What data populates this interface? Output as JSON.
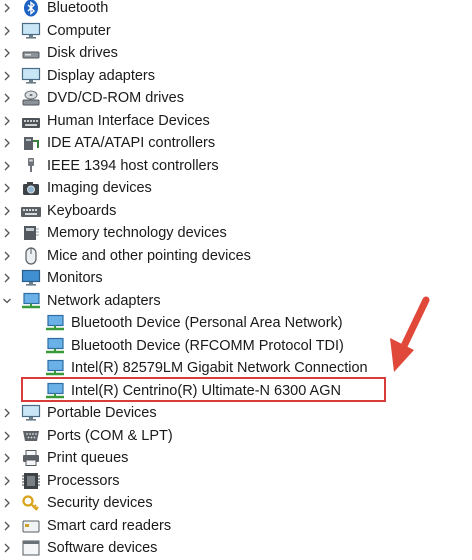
{
  "tree": {
    "items": [
      {
        "label": "Bluetooth",
        "icon": "bluetooth-icon",
        "expanded": false
      },
      {
        "label": "Computer",
        "icon": "monitor-icon",
        "expanded": false
      },
      {
        "label": "Disk drives",
        "icon": "disk-drive-icon",
        "expanded": false
      },
      {
        "label": "Display adapters",
        "icon": "display-adapter-icon",
        "expanded": false
      },
      {
        "label": "DVD/CD-ROM drives",
        "icon": "dvd-drive-icon",
        "expanded": false
      },
      {
        "label": "Human Interface Devices",
        "icon": "hid-icon",
        "expanded": false
      },
      {
        "label": "IDE ATA/ATAPI controllers",
        "icon": "ide-controller-icon",
        "expanded": false
      },
      {
        "label": "IEEE 1394 host controllers",
        "icon": "ieee1394-icon",
        "expanded": false
      },
      {
        "label": "Imaging devices",
        "icon": "camera-icon",
        "expanded": false
      },
      {
        "label": "Keyboards",
        "icon": "keyboard-icon",
        "expanded": false
      },
      {
        "label": "Memory technology devices",
        "icon": "memory-icon",
        "expanded": false
      },
      {
        "label": "Mice and other pointing devices",
        "icon": "mouse-icon",
        "expanded": false
      },
      {
        "label": "Monitors",
        "icon": "monitor-icon",
        "expanded": false
      },
      {
        "label": "Network adapters",
        "icon": "network-adapter-icon",
        "expanded": true
      },
      {
        "label": "Bluetooth Device (Personal Area Network)",
        "icon": "network-adapter-icon",
        "child": true
      },
      {
        "label": "Bluetooth Device (RFCOMM Protocol TDI)",
        "icon": "network-adapter-icon",
        "child": true
      },
      {
        "label": "Intel(R) 82579LM Gigabit Network Connection",
        "icon": "network-adapter-icon",
        "child": true
      },
      {
        "label": "Intel(R) Centrino(R) Ultimate-N 6300 AGN",
        "icon": "network-adapter-icon",
        "child": true,
        "highlighted": true
      },
      {
        "label": "Portable Devices",
        "icon": "portable-device-icon",
        "expanded": false
      },
      {
        "label": "Ports (COM & LPT)",
        "icon": "port-icon",
        "expanded": false
      },
      {
        "label": "Print queues",
        "icon": "printer-icon",
        "expanded": false
      },
      {
        "label": "Processors",
        "icon": "processor-icon",
        "expanded": false
      },
      {
        "label": "Security devices",
        "icon": "security-icon",
        "expanded": false
      },
      {
        "label": "Smart card readers",
        "icon": "smart-card-icon",
        "expanded": false
      },
      {
        "label": "Software devices",
        "icon": "software-device-icon",
        "expanded": false
      }
    ]
  },
  "annotation": {
    "box_color": "#d93a3a",
    "arrow_color": "#e0483a"
  }
}
